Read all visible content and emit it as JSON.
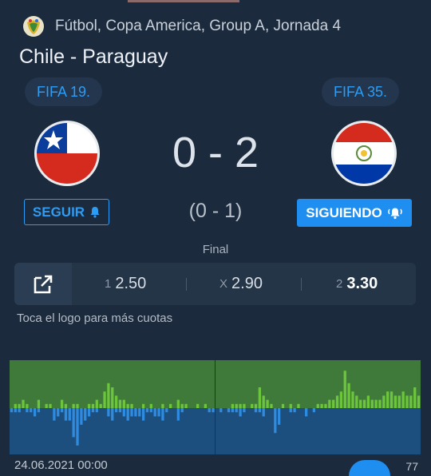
{
  "header": {
    "competition": "Fútbol, Copa America, Group A, Jornada 4",
    "cup_icon": "copa-america-logo"
  },
  "match": {
    "title": "Chile - Paraguay",
    "home": {
      "ranking": "FIFA 19.",
      "flag": "chile-flag",
      "follow_label": "SEGUIR",
      "follow_icon": "bell-icon"
    },
    "away": {
      "ranking": "FIFA 35.",
      "flag": "paraguay-flag",
      "follow_label": "SIGUIENDO",
      "follow_icon": "bell-ringing-icon"
    },
    "score": "0 - 2",
    "halftime": "(0 - 1)",
    "status": "Final"
  },
  "odds": {
    "logo_icon": "external-link-icon",
    "items": [
      {
        "label": "1",
        "value": "2.50",
        "best": false
      },
      {
        "label": "X",
        "value": "2.90",
        "best": false
      },
      {
        "label": "2",
        "value": "3.30",
        "best": true
      }
    ],
    "hint": "Toca el logo para más cuotas"
  },
  "momentum": {
    "colors": {
      "home_bg": "#3f7a3a",
      "away_bg": "#1c4f7e",
      "home_bar": "#6cc53d",
      "away_bar": "#2f8be0"
    },
    "home": [
      0,
      1,
      1,
      2,
      1,
      0,
      0,
      2,
      0,
      1,
      1,
      0,
      0,
      2,
      1,
      0,
      1,
      1,
      0,
      0,
      1,
      1,
      2,
      1,
      4,
      6,
      5,
      3,
      2,
      2,
      1,
      1,
      0,
      0,
      1,
      0,
      1,
      0,
      0,
      1,
      0,
      1,
      0,
      2,
      1,
      1,
      0,
      0,
      1,
      0,
      1,
      0,
      0,
      0,
      0,
      0,
      0,
      1,
      1,
      1,
      1,
      0,
      1,
      1,
      5,
      3,
      2,
      1,
      0,
      0,
      1,
      0,
      1,
      0,
      1,
      0,
      0,
      0,
      0,
      1,
      1,
      1,
      2,
      2,
      3,
      4,
      9,
      6,
      4,
      3,
      2,
      2,
      3,
      2,
      2,
      2,
      3,
      4,
      4,
      3,
      3,
      4,
      3,
      3,
      5,
      3
    ],
    "away": [
      1,
      1,
      1,
      0,
      1,
      1,
      2,
      1,
      0,
      0,
      0,
      3,
      2,
      1,
      3,
      3,
      7,
      9,
      4,
      3,
      2,
      1,
      1,
      0,
      0,
      2,
      3,
      1,
      1,
      2,
      3,
      2,
      2,
      2,
      3,
      1,
      1,
      2,
      2,
      3,
      1,
      0,
      0,
      3,
      1,
      0,
      0,
      0,
      0,
      0,
      0,
      1,
      1,
      0,
      1,
      0,
      1,
      1,
      1,
      2,
      1,
      0,
      0,
      1,
      1,
      2,
      0,
      0,
      6,
      4,
      0,
      0,
      1,
      1,
      0,
      0,
      2,
      0,
      1,
      0,
      0,
      0,
      0,
      0,
      0,
      0,
      0,
      0,
      0,
      0,
      0,
      0,
      0,
      0,
      0,
      0,
      0,
      0,
      0,
      0,
      0,
      0,
      0,
      0,
      0,
      0
    ]
  },
  "footer": {
    "date_fragment": "24.06.2021 00:00",
    "right_fragment": "77"
  }
}
